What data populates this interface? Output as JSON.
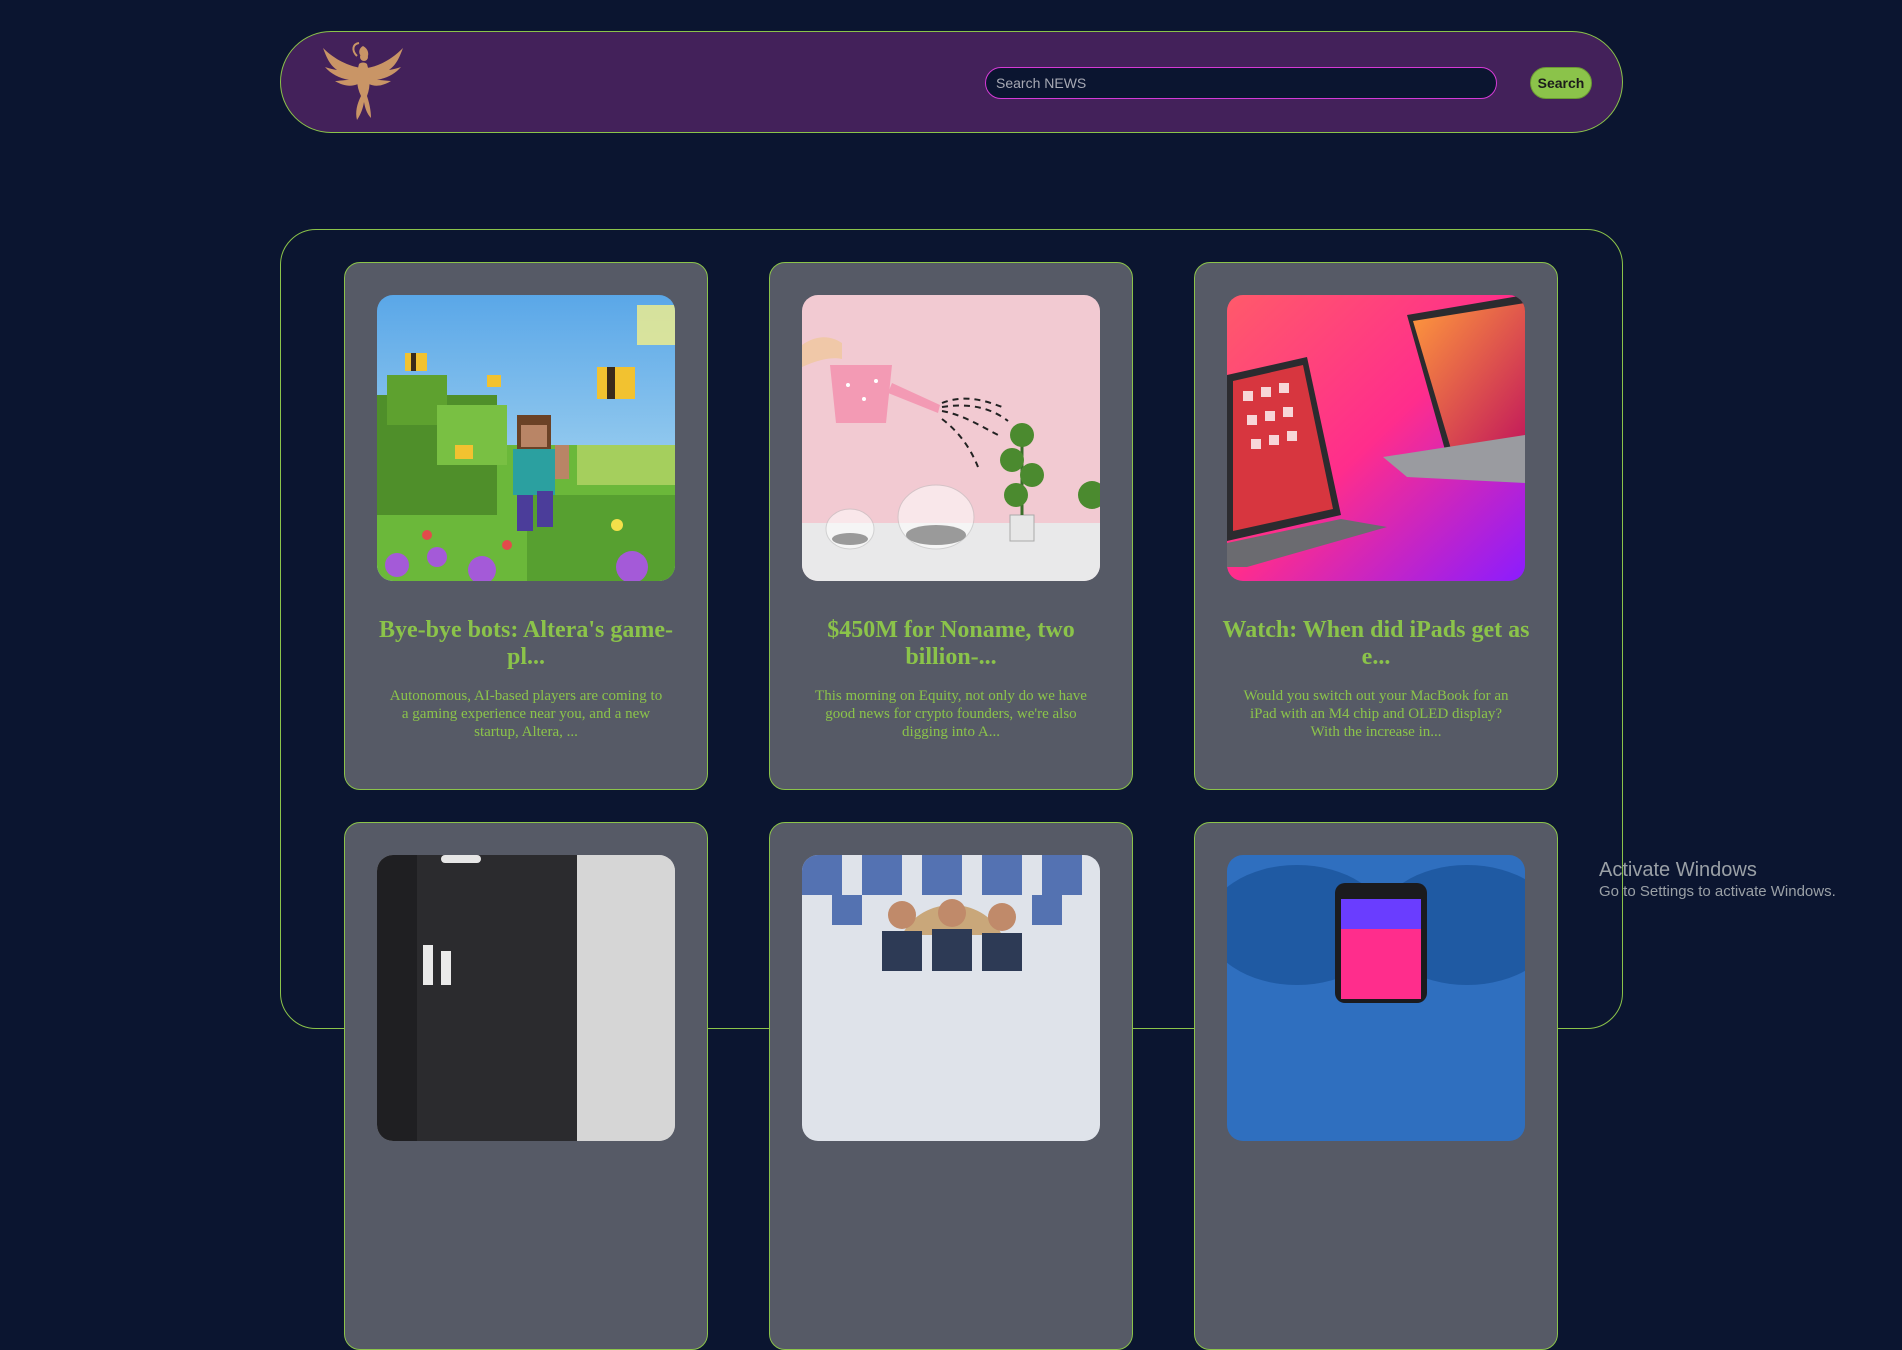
{
  "header": {
    "logo": "phoenix-logo",
    "search_placeholder": "Search NEWS",
    "search_value": "",
    "search_button_label": "Search"
  },
  "articles": [
    {
      "title": "Bye-bye bots: Altera's game-pl...",
      "description": "Autonomous, AI-based players are coming to a gaming experience near you, and a new startup, Altera, ...",
      "image": "minecraft-scene"
    },
    {
      "title": "$450M for Noname, two billion-...",
      "description": "This morning on Equity, not only do we have good news for crypto founders, we're also digging into A...",
      "image": "watering-can-piggy-banks"
    },
    {
      "title": "Watch: When did iPads get as e...",
      "description": "Would you switch out your MacBook for an iPad with an M4 chip and OLED display? With the increase in...",
      "image": "ipad-and-macbook"
    },
    {
      "title": "",
      "description": "",
      "image": "blurred-phone"
    },
    {
      "title": "",
      "description": "",
      "image": "three-founders-tiles"
    },
    {
      "title": "",
      "description": "",
      "image": "phone-on-knees"
    }
  ],
  "watermark": {
    "title": "Activate Windows",
    "subtitle": "Go to Settings to activate Windows."
  },
  "colors": {
    "background": "#0b1530",
    "header": "#43215a",
    "accent": "#8bc34a",
    "card": "#565a66",
    "search_border": "#d63ad6"
  }
}
